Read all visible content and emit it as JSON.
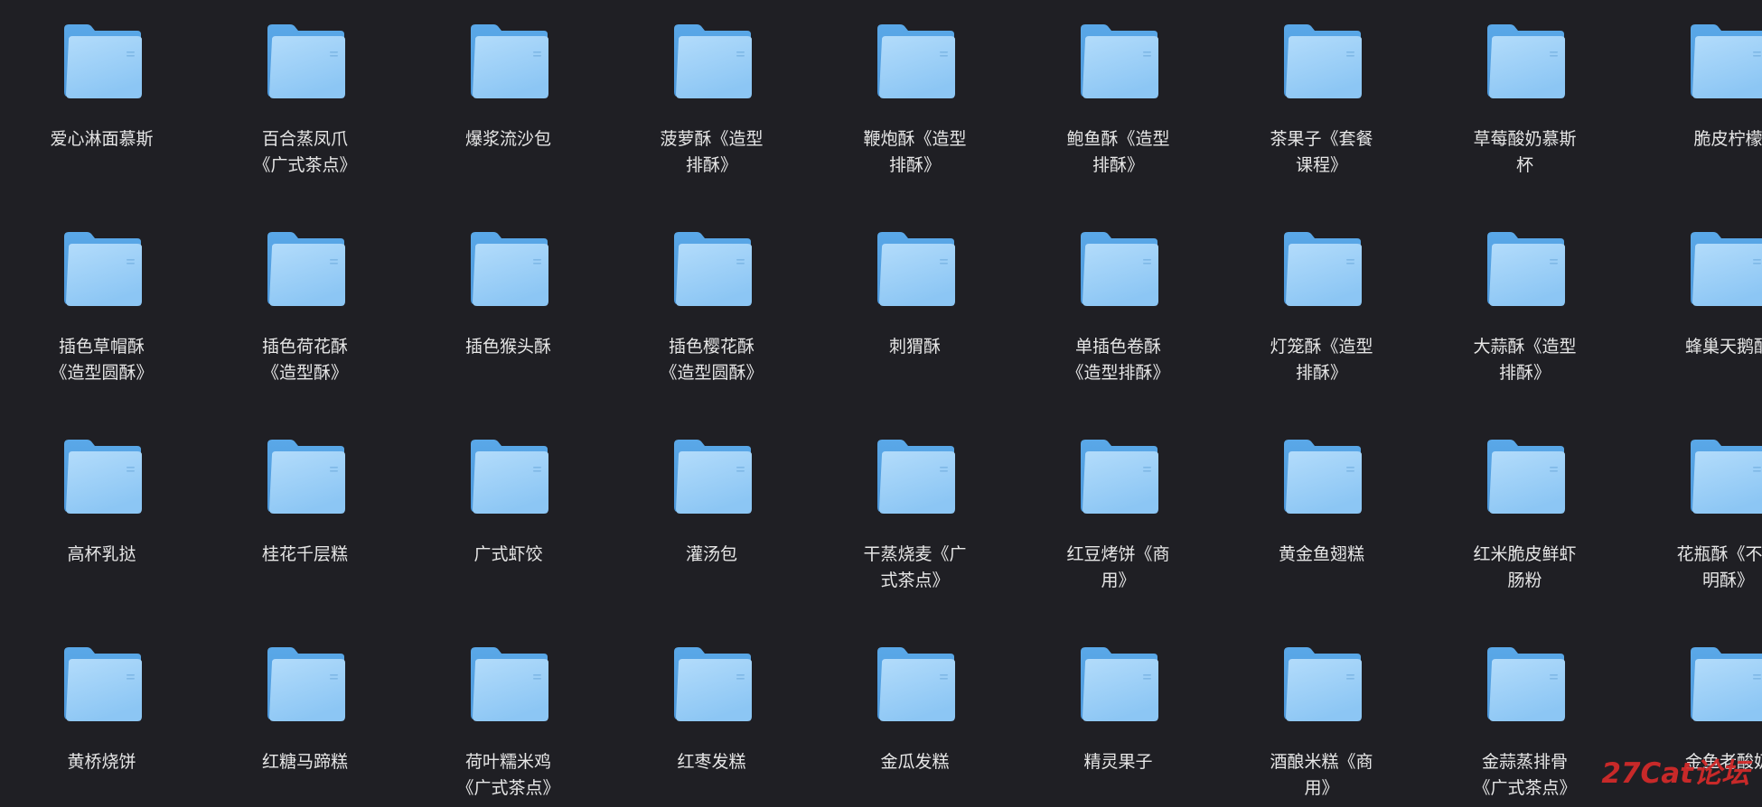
{
  "folders": [
    {
      "label": "爱心淋面慕斯"
    },
    {
      "label": "百合蒸凤爪《广式茶点》"
    },
    {
      "label": "爆浆流沙包"
    },
    {
      "label": "菠萝酥《造型排酥》"
    },
    {
      "label": "鞭炮酥《造型排酥》"
    },
    {
      "label": "鲍鱼酥《造型排酥》"
    },
    {
      "label": "茶果子《套餐课程》"
    },
    {
      "label": "草莓酸奶慕斯杯"
    },
    {
      "label": "脆皮柠檬"
    },
    {
      "label": "插色草帽酥《造型圆酥》"
    },
    {
      "label": "插色荷花酥《造型酥》"
    },
    {
      "label": "插色猴头酥"
    },
    {
      "label": "插色樱花酥《造型圆酥》"
    },
    {
      "label": "刺猬酥"
    },
    {
      "label": "单插色卷酥《造型排酥》"
    },
    {
      "label": "灯笼酥《造型排酥》"
    },
    {
      "label": "大蒜酥《造型排酥》"
    },
    {
      "label": "蜂巢天鹅酥"
    },
    {
      "label": "高杯乳挞"
    },
    {
      "label": "桂花千层糕"
    },
    {
      "label": "广式虾饺"
    },
    {
      "label": "灌汤包"
    },
    {
      "label": "干蒸烧麦《广式茶点》"
    },
    {
      "label": "红豆烤饼《商用》"
    },
    {
      "label": "黄金鱼翅糕"
    },
    {
      "label": "红米脆皮鲜虾肠粉"
    },
    {
      "label": "花瓶酥《不冻明酥》"
    },
    {
      "label": "黄桥烧饼"
    },
    {
      "label": "红糖马蹄糕"
    },
    {
      "label": "荷叶糯米鸡《广式茶点》"
    },
    {
      "label": "红枣发糕"
    },
    {
      "label": "金瓜发糕"
    },
    {
      "label": "精灵果子"
    },
    {
      "label": "酒酿米糕《商用》"
    },
    {
      "label": "金蒜蒸排骨《广式茶点》"
    },
    {
      "label": "金鱼老酸奶"
    }
  ],
  "icon": "folder-icon",
  "colors": {
    "background": "#1f1f24",
    "folder_back": "#62aeea",
    "folder_front_top": "#b3dcfb",
    "folder_front_bottom": "#8fc8f5",
    "label": "#e6e6e6",
    "watermark": "#d62a2a"
  },
  "watermark": "27Cat论坛"
}
